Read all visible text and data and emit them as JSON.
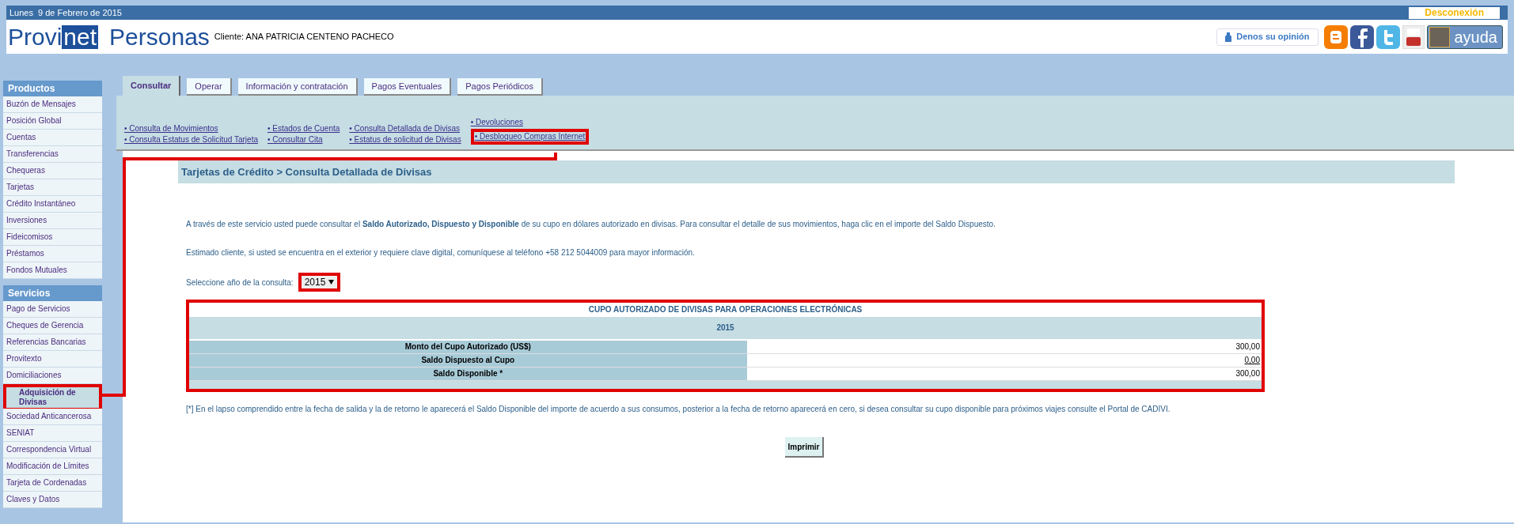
{
  "top_bar": {
    "date": "Lunes  9 de Febrero de 2015",
    "logout": "Desconexión"
  },
  "header": {
    "logo": {
      "left": "Provi",
      "boxed": "net",
      "right": "Personas"
    },
    "client": "Cliente: ANA PATRICIA CENTENO PACHECO",
    "feedback": "Denos su opinión",
    "help": "ayuda",
    "social": [
      {
        "kind": "blogger"
      },
      {
        "kind": "facebook"
      },
      {
        "kind": "twitter"
      },
      {
        "kind": "youtube"
      }
    ]
  },
  "sidebar": [
    {
      "title": "Productos",
      "items": [
        {
          "label": "Buzón de Mensajes",
          "selected": false,
          "annotated": false
        },
        {
          "label": "Posición Global",
          "selected": false,
          "annotated": false
        },
        {
          "label": "Cuentas",
          "selected": false,
          "annotated": false
        },
        {
          "label": "Transferencias",
          "selected": false,
          "annotated": false
        },
        {
          "label": "Chequeras",
          "selected": false,
          "annotated": false
        },
        {
          "label": "Tarjetas",
          "selected": false,
          "annotated": false
        },
        {
          "label": "Crédito Instantáneo",
          "selected": false,
          "annotated": false
        },
        {
          "label": "Inversiones",
          "selected": false,
          "annotated": false
        },
        {
          "label": "Fideicomisos",
          "selected": false,
          "annotated": false
        },
        {
          "label": "Préstamos",
          "selected": false,
          "annotated": false
        },
        {
          "label": "Fondos Mutuales",
          "selected": false,
          "annotated": false
        }
      ]
    },
    {
      "title": "Servicios",
      "items": [
        {
          "label": "Pago de Servicios",
          "selected": false,
          "annotated": false
        },
        {
          "label": "Cheques de Gerencia",
          "selected": false,
          "annotated": false
        },
        {
          "label": "Referencias Bancarias",
          "selected": false,
          "annotated": false
        },
        {
          "label": "Provitexto",
          "selected": false,
          "annotated": false
        },
        {
          "label": "Domiciliaciones",
          "selected": false,
          "annotated": false
        },
        {
          "label": "Adquisición de Divisas",
          "selected": true,
          "annotated": true
        },
        {
          "label": "Sociedad Anticancerosa",
          "selected": false,
          "annotated": false
        },
        {
          "label": "SENIAT",
          "selected": false,
          "annotated": false
        },
        {
          "label": "Correspondencia Virtual",
          "selected": false,
          "annotated": false
        },
        {
          "label": "Modificación de Límites",
          "selected": false,
          "annotated": false
        },
        {
          "label": "Tarjeta de Cordenadas",
          "selected": false,
          "annotated": false
        },
        {
          "label": "Claves y Datos",
          "selected": false,
          "annotated": false
        }
      ]
    }
  ],
  "tabs": [
    {
      "label": "Consultar",
      "selected": true
    },
    {
      "label": "Operar",
      "selected": false
    },
    {
      "label": "Información y contratación",
      "selected": false
    },
    {
      "label": "Pagos Eventuales",
      "selected": false
    },
    {
      "label": "Pagos Periódicos",
      "selected": false
    }
  ],
  "submenu": [
    [
      {
        "label": "• Consulta de Movimientos",
        "annotated": false
      },
      {
        "label": "• Consulta Estatus de Solicitud Tarjeta",
        "annotated": false
      }
    ],
    [
      {
        "label": "• Estados de Cuenta",
        "annotated": false
      },
      {
        "label": "• Consultar Cita",
        "annotated": false
      }
    ],
    [
      {
        "label": "• Consulta Detallada de Divisas",
        "annotated": false
      },
      {
        "label": "• Estatus de solicitud de Divisas",
        "annotated": false
      }
    ],
    [
      {
        "label": "• Devoluciones",
        "annotated": false
      },
      {
        "label": "• Desbloqueo Compras Internet",
        "annotated": true
      }
    ]
  ],
  "page_title": "Tarjetas de Crédito > Consulta Detallada de Divisas",
  "intro": "A través de este servicio usted puede consultar el **Saldo Autorizado, Dispuesto y Disponible** de su cupo en dólares autorizado en divisas. Para consultar el detalle de sus movimientos, haga clic en el importe del Saldo Dispuesto.",
  "notice": "Estimado cliente, si usted se encuentra en el exterior y requiere clave digital, comuníquese al teléfono +58 212 5044009 para mayor información.",
  "year_select": {
    "label": "Seleccione año de la consulta:",
    "value": "2015",
    "annotated": true
  },
  "table": {
    "title": "CUPO AUTORIZADO DE DIVISAS PARA OPERACIONES ELECTRÓNICAS",
    "year": "2015",
    "annotated": true,
    "rows": [
      {
        "label": "Monto del Cupo Autorizado (US$)",
        "value": "300,00",
        "kind": "text"
      },
      {
        "label": "Saldo Dispuesto al Cupo",
        "value": "0,00",
        "kind": "link"
      },
      {
        "label": "Saldo Disponible *",
        "value": "300,00",
        "kind": "text"
      }
    ]
  },
  "footnote": "[*] En el lapso comprendido entre la fecha de salida y la de retorno le aparecerá el Saldo Disponible del importe de acuerdo a sus consumos, posterior a la fecha de retorno aparecerá en cero, si desea consultar su cupo disponible para próximos viajes consulte el Portal de CADIVI.",
  "print_button": "Imprimir"
}
